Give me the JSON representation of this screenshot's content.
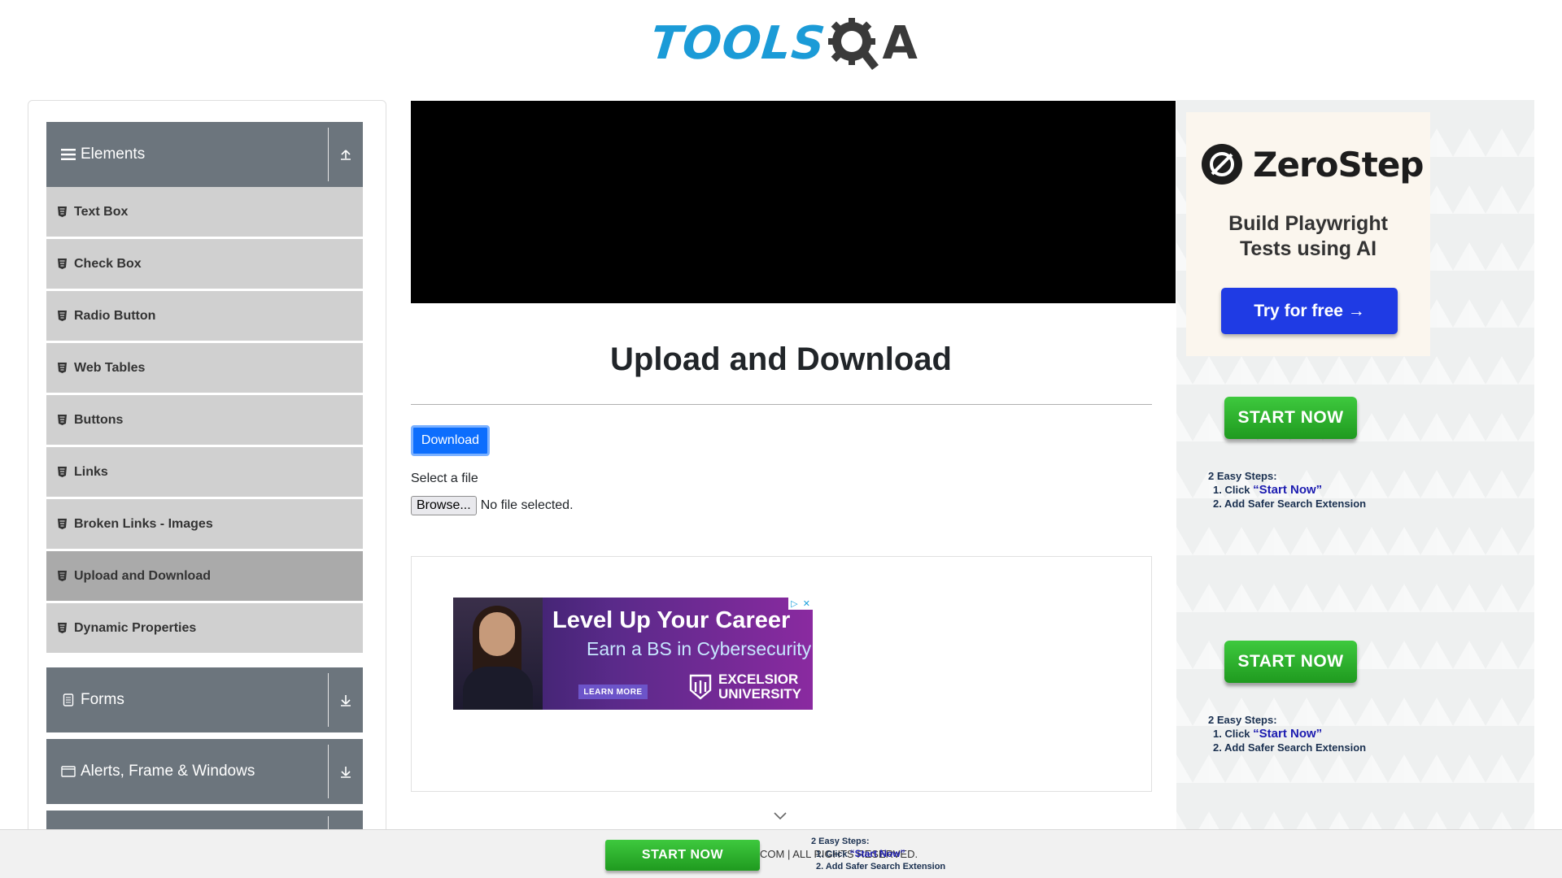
{
  "logo": {
    "part1": "TOOLS",
    "part2": "A"
  },
  "sidebar": {
    "groups": [
      {
        "label": "Elements",
        "icon": "hamburger-icon",
        "toggle": "collapse-up-icon"
      },
      {
        "label": "Forms",
        "icon": "document-icon",
        "toggle": "expand-down-icon"
      },
      {
        "label": "Alerts, Frame & Windows",
        "icon": "window-icon",
        "toggle": "expand-down-icon"
      }
    ],
    "items": [
      {
        "label": "Text Box"
      },
      {
        "label": "Check Box"
      },
      {
        "label": "Radio Button"
      },
      {
        "label": "Web Tables"
      },
      {
        "label": "Buttons"
      },
      {
        "label": "Links"
      },
      {
        "label": "Broken Links - Images"
      },
      {
        "label": "Upload and Download",
        "active": true
      },
      {
        "label": "Dynamic Properties"
      }
    ]
  },
  "main": {
    "title": "Upload and Download",
    "download_label": "Download",
    "select_label": "Select a file",
    "browse_label": "Browse...",
    "file_status": "No file selected."
  },
  "banner_ad": {
    "headline": "Level Up Your Career",
    "subline": "Earn a BS in Cybersecurity",
    "cta": "LEARN MORE",
    "uni_line1": "EXCELSIOR",
    "uni_line2": "UNIVERSITY"
  },
  "right_ads": {
    "zerostep": {
      "name": "ZeroStep",
      "tagline_line1": "Build Playwright",
      "tagline_line2": "Tests using AI",
      "cta": "Try for free →"
    },
    "start_now_label": "START NOW",
    "steps_title": "2 Easy Steps:",
    "step1_prefix": "1. Click ",
    "step1_highlight": "“Start Now”",
    "step2": "2. Add Safer Search Extension"
  },
  "footer": {
    "start_now_label": "START NOW",
    "copyright": "COM | ALL RIGHTS RESERVED.",
    "steps_title": "2 Easy Steps:",
    "step1_prefix": "1. Click ",
    "step1_highlight": "“Start Now”",
    "step2": "2. Add Safer Search Extension"
  },
  "colors": {
    "group_header": "#6c757d",
    "menu_item": "#d0d0d0",
    "menu_item_active": "#aaaaaa",
    "primary_button": "#0d6efd",
    "logo_blue": "#1b9bd7",
    "start_green": "#2bb02b",
    "zerostep_blue": "#1f3be4"
  }
}
